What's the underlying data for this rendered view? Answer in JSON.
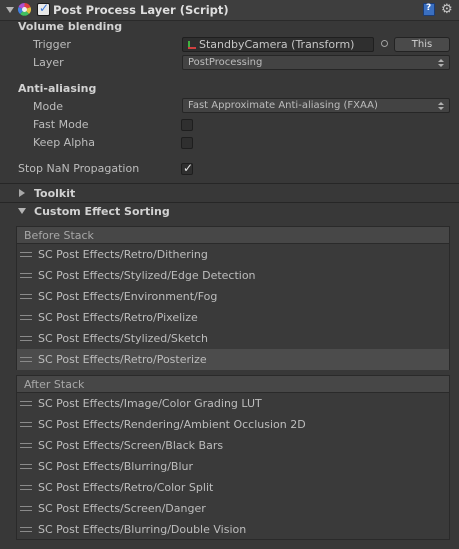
{
  "header": {
    "title": "Post Process Layer (Script)"
  },
  "volume_blending": {
    "section_label": "Volume blending",
    "trigger_label": "Trigger",
    "trigger_value": "StandbyCamera (Transform)",
    "this_button": "This",
    "layer_label": "Layer",
    "layer_value": "PostProcessing"
  },
  "anti_aliasing": {
    "section_label": "Anti-aliasing",
    "mode_label": "Mode",
    "mode_value": "Fast Approximate Anti-aliasing (FXAA)",
    "fast_mode_label": "Fast Mode",
    "fast_mode_checked": false,
    "keep_alpha_label": "Keep Alpha",
    "keep_alpha_checked": false
  },
  "stop_nan": {
    "label": "Stop NaN Propagation",
    "checked": true
  },
  "toolkit": {
    "label": "Toolkit"
  },
  "custom_effect_sorting": {
    "label": "Custom Effect Sorting"
  },
  "before_stack": {
    "header": "Before Stack",
    "items": [
      "SC Post Effects/Retro/Dithering",
      "SC Post Effects/Stylized/Edge Detection",
      "SC Post Effects/Environment/Fog",
      "SC Post Effects/Retro/Pixelize",
      "SC Post Effects/Stylized/Sketch",
      "SC Post Effects/Retro/Posterize"
    ],
    "selected_index": 5
  },
  "after_stack": {
    "header": "After Stack",
    "items": [
      "SC Post Effects/Image/Color Grading LUT",
      "SC Post Effects/Rendering/Ambient Occlusion 2D",
      "SC Post Effects/Screen/Black Bars",
      "SC Post Effects/Blurring/Blur",
      "SC Post Effects/Retro/Color Split",
      "SC Post Effects/Screen/Danger",
      "SC Post Effects/Blurring/Double Vision"
    ]
  },
  "icons": {
    "fold": "triangle-down-icon",
    "component": "post-process-layer-icon",
    "help": "help-book-icon",
    "settings": "gear-icon",
    "object_picker": "object-picker-circle-icon",
    "transform": "transform-icon",
    "drag_handle": "drag-handle-icon"
  }
}
